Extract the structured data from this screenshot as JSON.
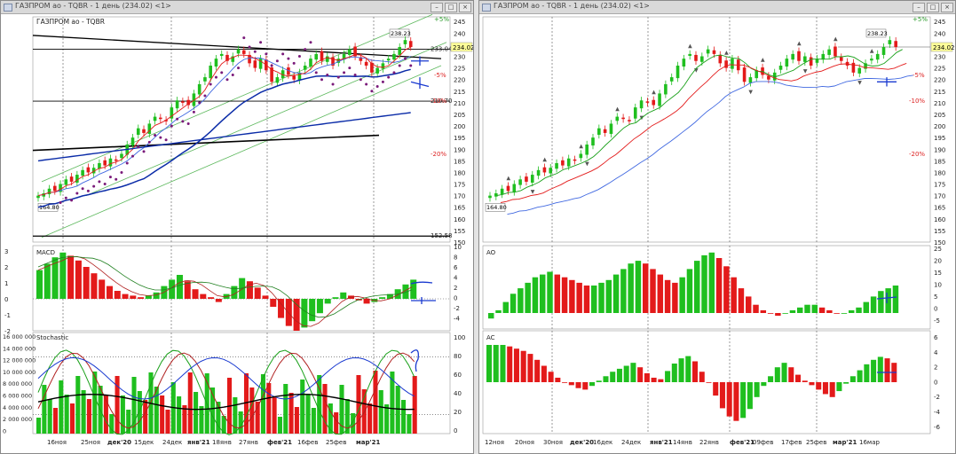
{
  "left_window": {
    "title": "ГАЗПРОМ ао - TQBR - 1 день (234.02) <1>",
    "instrument_label": "ГАЗПРОМ ао - TQBR",
    "panels": {
      "price": {
        "y_ticks": [
          "245",
          "240",
          "235",
          "230",
          "225",
          "220",
          "215",
          "210",
          "205",
          "200",
          "195",
          "190",
          "185",
          "180",
          "175",
          "170",
          "165",
          "160",
          "155",
          "150"
        ],
        "labels": {
          "last": "234.02",
          "high": "238.23",
          "low": "164.80",
          "level_233": "233.04",
          "level_210": "210.70",
          "level_152": "152.58",
          "pct_plus5": "+5%",
          "pct_minus5": "-5%",
          "pct_minus10": "-10%",
          "pct_minus20": "-20%"
        }
      },
      "macd": {
        "label": "MACD",
        "left_ticks": [
          "3",
          "2",
          "1",
          "0",
          "-1",
          "-2"
        ],
        "right_ticks": [
          "10",
          "8",
          "6",
          "4",
          "2",
          "0",
          "-2",
          "-4"
        ]
      },
      "stochastic": {
        "label": "Stochastic",
        "left_ticks": [
          "16 000 000",
          "14 000 000",
          "12 000 000",
          "10 000 000",
          "8 000 000",
          "6 000 000",
          "4 000 000",
          "2 000 000",
          "0"
        ],
        "right_ticks": [
          "100",
          "80",
          "60",
          "40",
          "20",
          "0"
        ]
      }
    },
    "x_labels": [
      "16ноя",
      "25ноя",
      "дек'20",
      "15дек",
      "24дек",
      "янв'21",
      "18янв",
      "27янв",
      "фев'21",
      "16фев",
      "25фев",
      "мар'21"
    ]
  },
  "right_window": {
    "title": "ГАЗПРОМ ао - TQBR - 1 день (234.02) <1>",
    "panels": {
      "price": {
        "y_ticks": [
          "245",
          "240",
          "235",
          "230",
          "225",
          "220",
          "215",
          "210",
          "205",
          "200",
          "195",
          "190",
          "185",
          "180",
          "175",
          "170",
          "165",
          "160",
          "155",
          "150"
        ],
        "labels": {
          "last": "234.02",
          "high": "238.23",
          "low": "164.80",
          "pct_plus5": "+5%",
          "pct_minus5": "-5%",
          "pct_minus10": "-10%",
          "pct_minus20": "-20%"
        }
      },
      "ao": {
        "label": "AO",
        "right_ticks": [
          "25",
          "20",
          "15",
          "10",
          "5",
          "0",
          "-5"
        ]
      },
      "ac": {
        "label": "AC",
        "right_ticks": [
          "6",
          "4",
          "2",
          "0",
          "-2",
          "-4",
          "-6"
        ]
      }
    },
    "x_labels": [
      "12ноя",
      "20ноя",
      "30ноя",
      "дек'20",
      "16дек",
      "24дек",
      "янв'21",
      "14янв",
      "22янв",
      "фев'21",
      "09фев",
      "17фев",
      "25фев",
      "мар'21",
      "16мар"
    ]
  },
  "chart_data": [
    {
      "type": "candlestick",
      "ylim": [
        150,
        247
      ],
      "close": [
        170,
        171,
        173,
        172,
        175,
        177,
        176,
        179,
        181,
        180,
        182,
        184,
        183,
        186,
        185,
        188,
        192,
        195,
        199,
        197,
        201,
        204,
        203,
        202,
        208,
        211,
        210,
        209,
        214,
        218,
        221,
        226,
        229,
        231,
        228,
        230,
        233,
        231,
        227,
        225,
        229,
        224,
        219,
        221,
        224,
        222,
        220,
        223,
        226,
        229,
        231,
        228,
        230,
        226,
        229,
        231,
        233,
        230,
        228,
        226,
        223,
        225,
        227,
        229,
        231,
        234,
        237,
        234
      ],
      "series": [
        {
          "name": "",
          "values_from": "close",
          "period": 20
        },
        {
          "name": "",
          "values_from": "close",
          "period": 50
        }
      ],
      "levels": [
        233.04,
        210.7,
        152.58
      ]
    },
    {
      "type": "bar",
      "name": "MACD",
      "values": [
        1.8,
        2.2,
        2.6,
        2.9,
        2.7,
        2.4,
        2.0,
        1.6,
        1.2,
        0.8,
        0.5,
        0.3,
        0.2,
        0.1,
        0.2,
        0.4,
        0.8,
        1.2,
        1.5,
        1.1,
        0.6,
        0.3,
        0.1,
        -0.2,
        0.3,
        0.8,
        1.3,
        1.1,
        0.7,
        0.2,
        -0.5,
        -1.2,
        -1.7,
        -2.0,
        -1.8,
        -1.4,
        -0.9,
        -0.3,
        0.1,
        0.4,
        0.2,
        -0.1,
        -0.3,
        -0.2,
        0.1,
        0.3,
        0.6,
        0.9,
        1.2
      ]
    },
    {
      "type": "bar",
      "name": "AO",
      "values": [
        -2,
        1,
        4,
        7,
        9,
        11,
        13,
        14,
        15,
        14,
        13,
        12,
        11,
        10,
        10,
        11,
        12,
        14,
        16,
        18,
        19,
        18,
        16,
        14,
        12,
        11,
        13,
        16,
        19,
        21,
        22,
        20,
        17,
        13,
        9,
        6,
        3,
        1,
        0,
        -1,
        0,
        1,
        2,
        3,
        3,
        2,
        1,
        0,
        0,
        1,
        2,
        4,
        6,
        8,
        9,
        10
      ]
    },
    {
      "type": "bar",
      "name": "AC",
      "values": [
        5,
        5,
        5,
        4.8,
        4.5,
        4.2,
        3.8,
        3.0,
        2.2,
        1.4,
        0.6,
        0,
        -0.4,
        -0.8,
        -1,
        -0.5,
        0.2,
        0.8,
        1.4,
        1.8,
        2.2,
        2.6,
        2.0,
        1.2,
        0.6,
        0.4,
        1.5,
        2.5,
        3.2,
        3.5,
        2.8,
        1.4,
        0.0,
        -1.8,
        -3.5,
        -4.6,
        -5.2,
        -4.8,
        -3.6,
        -2.0,
        -0.5,
        0.8,
        2.0,
        2.6,
        2.0,
        1.0,
        0.2,
        -0.4,
        -1.0,
        -1.6,
        -2.0,
        -1.2,
        -0.2,
        0.8,
        1.6,
        2.4,
        3.0,
        3.4,
        3.2,
        2.6
      ]
    }
  ]
}
